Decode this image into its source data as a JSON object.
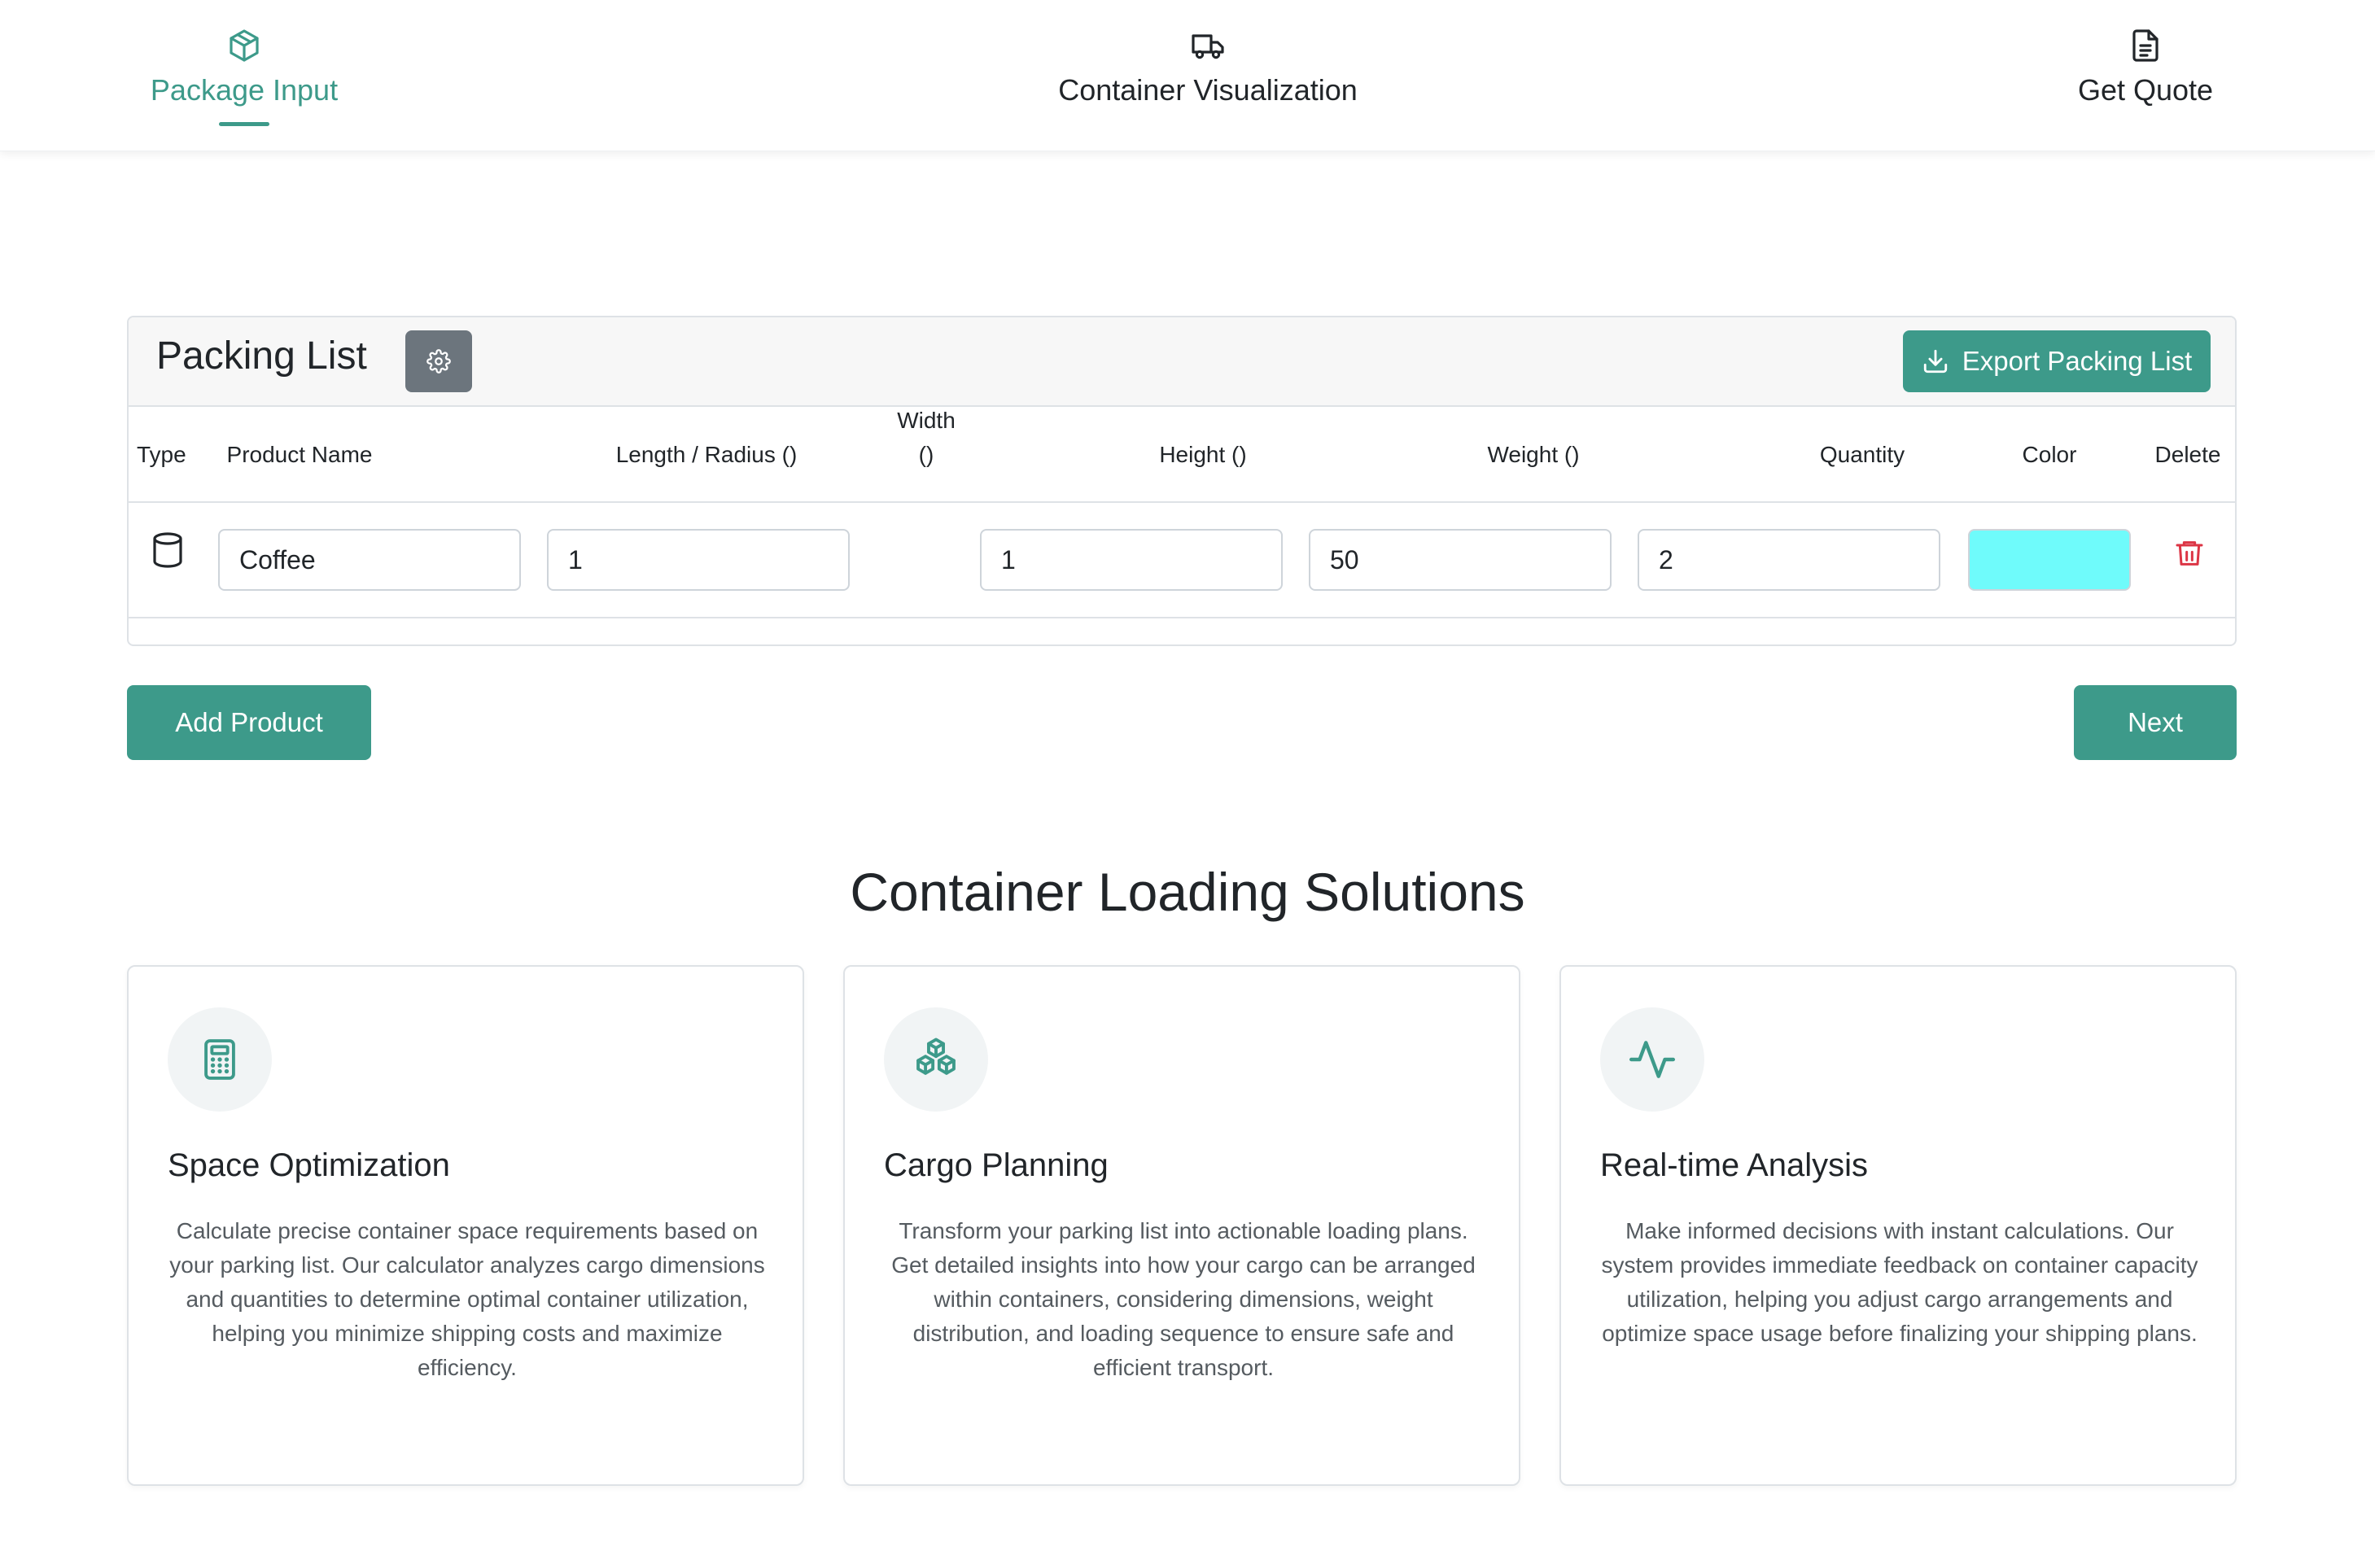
{
  "nav": {
    "tabs": [
      {
        "label": "Package Input",
        "icon": "package-icon",
        "active": true
      },
      {
        "label": "Container Visualization",
        "icon": "truck-icon",
        "active": false
      },
      {
        "label": "Get Quote",
        "icon": "document-icon",
        "active": false
      }
    ]
  },
  "packing_list": {
    "title": "Packing List",
    "settings_icon": "gear-icon",
    "export_label": "Export Packing List",
    "columns": {
      "type": "Type",
      "product_name": "Product Name",
      "length": "Length / Radius ()",
      "width_line1": "Width",
      "width_line2": "()",
      "height": "Height ()",
      "weight": "Weight ()",
      "quantity": "Quantity",
      "color": "Color",
      "delete": "Delete"
    },
    "rows": [
      {
        "type_icon": "cylinder-icon",
        "product_name": "Coffee",
        "length": "1",
        "height": "1",
        "weight": "50",
        "quantity": "2",
        "color": "#6ffbfb"
      }
    ]
  },
  "actions": {
    "add_product": "Add Product",
    "next": "Next"
  },
  "features": {
    "title": "Container Loading Solutions",
    "cards": [
      {
        "icon": "calculator-icon",
        "title": "Space Optimization",
        "description": "Calculate precise container space requirements based on your parking list. Our calculator analyzes cargo dimensions and quantities to determine optimal container utilization, helping you minimize shipping costs and maximize efficiency."
      },
      {
        "icon": "boxes-icon",
        "title": "Cargo Planning",
        "description": "Transform your parking list into actionable loading plans. Get detailed insights into how your cargo can be arranged within containers, considering dimensions, weight distribution, and loading sequence to ensure safe and efficient transport."
      },
      {
        "icon": "activity-icon",
        "title": "Real-time Analysis",
        "description": "Make informed decisions with instant calculations. Our system provides immediate feedback on container capacity utilization, helping you adjust cargo arrangements and optimize space usage before finalizing your shipping plans."
      }
    ]
  },
  "colors": {
    "accent": "#3d9a8a",
    "secondary_button": "#6c757d",
    "delete": "#dc3545"
  }
}
